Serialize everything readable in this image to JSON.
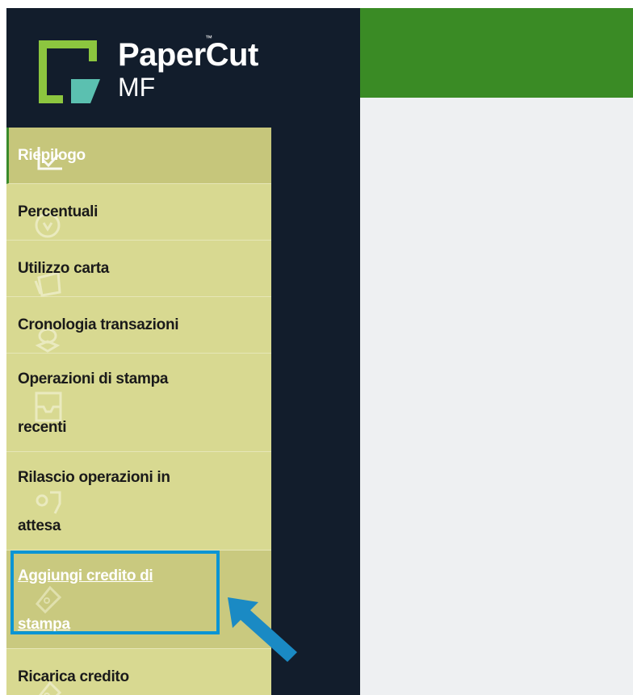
{
  "brand": {
    "name": "PaperCut",
    "product": "MF",
    "trademark": "™",
    "colors": {
      "green": "#8cc63f",
      "teal": "#5bc0b0"
    }
  },
  "sidebar": {
    "items": [
      {
        "label": "Riepilogo",
        "icon": "chart-icon",
        "state": "active"
      },
      {
        "label": "Percentuali",
        "icon": "coin-icon"
      },
      {
        "label": "Utilizzo carta",
        "icon": "paper-icon"
      },
      {
        "label": "Cronologia transazioni",
        "icon": "history-icon"
      },
      {
        "label": "Operazioni di stampa recenti",
        "line1": "Operazioni di stampa",
        "line2": "recenti",
        "icon": "printer-icon"
      },
      {
        "label": "Rilascio operazioni in attesa",
        "line1": "Rilascio operazioni in",
        "line2": "attesa",
        "icon": "release-icon"
      },
      {
        "label": "Aggiungi credito di stampa",
        "line1": "Aggiungi credito di",
        "line2": "stampa",
        "icon": "tag-icon",
        "state": "selected"
      },
      {
        "label": "Ricarica credito",
        "icon": "tag-icon"
      }
    ]
  },
  "colors": {
    "sidebar_bg": "#121d2c",
    "menu_bg": "#d8d991",
    "topbar_bg": "#3a8b25",
    "content_bg": "#eef0f2",
    "highlight": "#0a95d4",
    "arrow": "#1a8ac4"
  }
}
